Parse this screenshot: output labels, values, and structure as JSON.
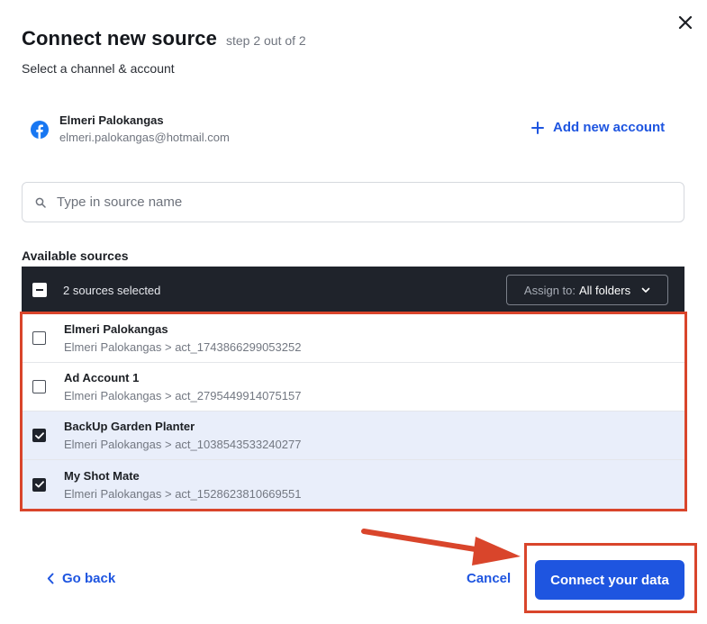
{
  "dialog": {
    "title": "Connect new source",
    "step": "step 2 out of 2",
    "subtitle": "Select a channel & account"
  },
  "account": {
    "icon": "facebook-icon",
    "name": "Elmeri Palokangas",
    "email": "elmeri.palokangas@hotmail.com"
  },
  "add_account_label": "Add new account",
  "search": {
    "placeholder": "Type in source name",
    "value": ""
  },
  "sources": {
    "label": "Available sources",
    "selected_text": "2 sources selected",
    "assign_prefix": "Assign to:",
    "assign_value": "All folders",
    "items": [
      {
        "title": "Elmeri Palokangas",
        "path": "Elmeri Palokangas > act_1743866299053252",
        "checked": false
      },
      {
        "title": "Ad Account 1",
        "path": "Elmeri Palokangas > act_2795449914075157",
        "checked": false
      },
      {
        "title": "BackUp Garden Planter",
        "path": "Elmeri Palokangas > act_1038543533240277",
        "checked": true
      },
      {
        "title": "My Shot Mate",
        "path": "Elmeri Palokangas > act_1528623810669551",
        "checked": true
      }
    ]
  },
  "footer": {
    "back_label": "Go back",
    "cancel_label": "Cancel",
    "connect_label": "Connect your data"
  },
  "colors": {
    "accent": "#1e55e0",
    "header_bg": "#1f232b",
    "selected_row": "#e9eefa",
    "highlight": "#d9452b",
    "facebook": "#1877f2"
  }
}
